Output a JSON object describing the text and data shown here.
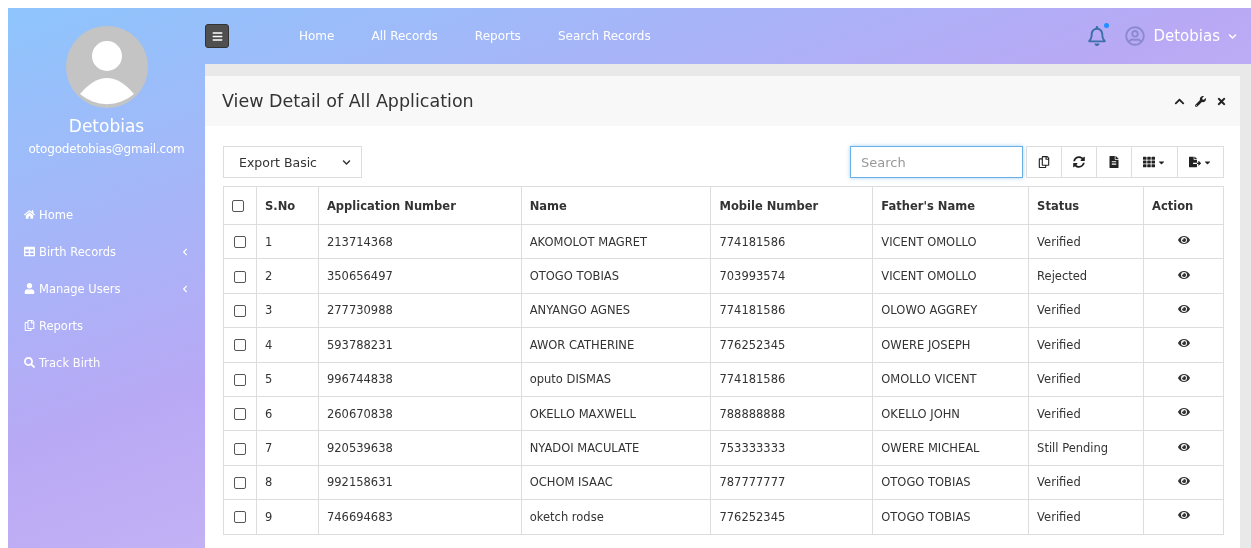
{
  "sidebar": {
    "user_name": "Detobias",
    "email": "otogodetobias@gmail.com",
    "items": [
      {
        "label": "Home",
        "submenu": false
      },
      {
        "label": "Birth Records",
        "submenu": true
      },
      {
        "label": "Manage Users",
        "submenu": true
      },
      {
        "label": "Reports",
        "submenu": false
      },
      {
        "label": "Track Birth",
        "submenu": false
      }
    ]
  },
  "topbar": {
    "nav": [
      "Home",
      "All Records",
      "Reports",
      "Search Records"
    ],
    "notification": true,
    "user": "Detobias"
  },
  "panel": {
    "title": "View Detail of All Application",
    "export_select": "Export Basic",
    "search": {
      "placeholder": "Search"
    },
    "table": {
      "header_checked": false,
      "columns": [
        "S.No",
        "Application Number",
        "Name",
        "Mobile Number",
        "Father's Name",
        "Status",
        "Action"
      ],
      "rows": [
        {
          "checked": false,
          "cells": [
            "1",
            "213714368",
            "AKOMOLOT MAGRET",
            "774181586",
            "VICENT OMOLLO",
            "Verified"
          ]
        },
        {
          "checked": false,
          "cells": [
            "2",
            "350656497",
            "OTOGO TOBIAS",
            "703993574",
            "VICENT OMOLLO",
            "Rejected"
          ]
        },
        {
          "checked": false,
          "cells": [
            "3",
            "277730988",
            "ANYANGO AGNES",
            "774181586",
            "OLOWO AGGREY",
            "Verified"
          ]
        },
        {
          "checked": false,
          "cells": [
            "4",
            "593788231",
            "AWOR CATHERINE",
            "776252345",
            "OWERE JOSEPH",
            "Verified"
          ]
        },
        {
          "checked": false,
          "cells": [
            "5",
            "996744838",
            "oputo DISMAS",
            "774181586",
            "OMOLLO VICENT",
            "Verified"
          ]
        },
        {
          "checked": false,
          "cells": [
            "6",
            "260670838",
            "OKELLO MAXWELL",
            "788888888",
            "OKELLO JOHN",
            "Verified"
          ]
        },
        {
          "checked": false,
          "cells": [
            "7",
            "920539638",
            "NYADOI MACULATE",
            "753333333",
            "OWERE MICHEAL",
            "Still Pending"
          ]
        },
        {
          "checked": false,
          "cells": [
            "8",
            "992158631",
            "OCHOM ISAAC",
            "787777777",
            "OTOGO TOBIAS",
            "Verified"
          ]
        },
        {
          "checked": false,
          "cells": [
            "9",
            "746694683",
            "oketch rodse",
            "776252345",
            "OTOGO TOBIAS",
            "Verified"
          ]
        }
      ]
    }
  }
}
